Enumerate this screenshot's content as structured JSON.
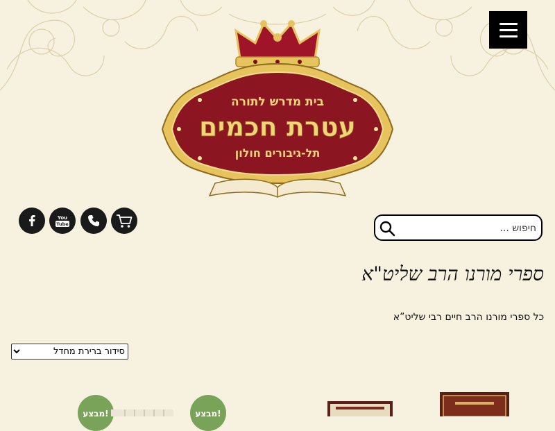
{
  "header": {
    "menu_icon": "hamburger-menu-icon",
    "logo": {
      "line1": "בית מדרש לתורה",
      "line2": "עטרת חכמים",
      "line3": "תל-גיבורים חולון"
    }
  },
  "social": {
    "cart_icon": "cart-icon",
    "phone_icon": "phone-icon",
    "youtube_icon": "youtube-icon",
    "facebook_icon": "facebook-icon"
  },
  "search": {
    "placeholder": "חיפוש ...",
    "icon": "search-icon"
  },
  "page": {
    "title": "ספרי מורנו הרב שליט\"א",
    "description": "כל ספרי מורנו הרב חיים רבי שליט”א"
  },
  "sort": {
    "selected": "סידור ברירת מחדל"
  },
  "products": {
    "sale_badges": [
      "מבצע!",
      "מבצע!"
    ]
  },
  "colors": {
    "background": "#f7f2e0",
    "logo_red": "#8b1622",
    "logo_gold": "#e7c35d",
    "sale_badge": "#7aa35a",
    "icon_circle": "#1a1a1a"
  }
}
